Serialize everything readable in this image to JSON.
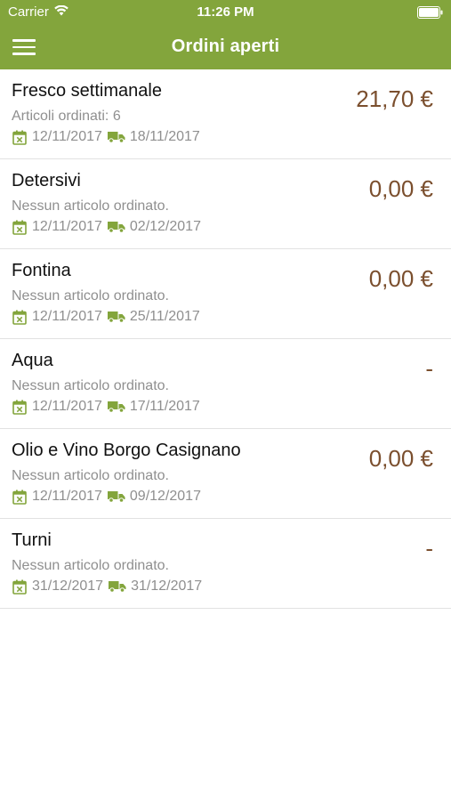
{
  "status_bar": {
    "carrier": "Carrier",
    "time": "11:26 PM"
  },
  "header": {
    "title": "Ordini aperti"
  },
  "colors": {
    "accent": "#83a53c",
    "price": "#7b4f2e",
    "secondary_text": "#8f8f8f"
  },
  "orders": [
    {
      "title": "Fresco settimanale",
      "subtitle": "Articoli ordinati: 6",
      "order_date": "12/11/2017",
      "delivery_date": "18/11/2017",
      "price": "21,70 €"
    },
    {
      "title": "Detersivi",
      "subtitle": "Nessun articolo ordinato.",
      "order_date": "12/11/2017",
      "delivery_date": "02/12/2017",
      "price": "0,00 €"
    },
    {
      "title": "Fontina",
      "subtitle": "Nessun articolo ordinato.",
      "order_date": "12/11/2017",
      "delivery_date": "25/11/2017",
      "price": "0,00 €"
    },
    {
      "title": "Aqua",
      "subtitle": "Nessun articolo ordinato.",
      "order_date": "12/11/2017",
      "delivery_date": "17/11/2017",
      "price": "-"
    },
    {
      "title": "Olio e Vino Borgo Casignano",
      "subtitle": "Nessun articolo ordinato.",
      "order_date": "12/11/2017",
      "delivery_date": "09/12/2017",
      "price": "0,00 €"
    },
    {
      "title": "Turni",
      "subtitle": "Nessun articolo ordinato.",
      "order_date": "31/12/2017",
      "delivery_date": "31/12/2017",
      "price": "-"
    }
  ]
}
